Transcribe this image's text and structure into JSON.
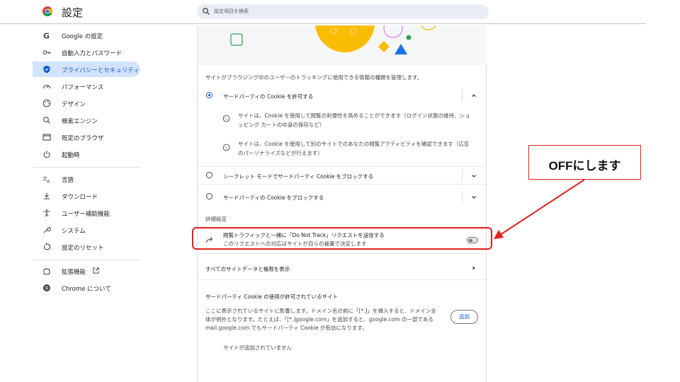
{
  "app": {
    "title": "設定"
  },
  "search": {
    "placeholder": "設定項目を検索"
  },
  "sidebar": {
    "items": [
      {
        "label": "Google の設定",
        "icon": "google-g-icon"
      },
      {
        "label": "自動入力とパスワード",
        "icon": "key-icon"
      },
      {
        "label": "プライバシーとセキュリティ",
        "icon": "shield-icon",
        "active": true
      },
      {
        "label": "パフォーマンス",
        "icon": "speedometer-icon"
      },
      {
        "label": "デザイン",
        "icon": "palette-icon"
      },
      {
        "label": "検索エンジン",
        "icon": "search-icon"
      },
      {
        "label": "既定のブラウザ",
        "icon": "browser-window-icon"
      },
      {
        "label": "起動時",
        "icon": "power-icon"
      },
      {
        "label": "言語",
        "icon": "translate-icon"
      },
      {
        "label": "ダウンロード",
        "icon": "download-icon"
      },
      {
        "label": "ユーザー補助機能",
        "icon": "accessibility-icon"
      },
      {
        "label": "システム",
        "icon": "wrench-icon"
      },
      {
        "label": "設定のリセット",
        "icon": "reset-icon"
      },
      {
        "label": "拡張機能",
        "icon": "puzzle-icon"
      },
      {
        "label": "Chrome について",
        "icon": "chrome-icon"
      }
    ]
  },
  "content": {
    "intro": "サイトがブラウジング中のユーザーのトラッキングに使用できる情報の種類を管理します。",
    "options": [
      {
        "label": "サードパーティの Cookie を許可する",
        "selected": true,
        "expanded": true
      },
      {
        "label": "シークレット モードでサードパーティ Cookie をブロックする",
        "selected": false
      },
      {
        "label": "サードパーティの Cookie をブロックする",
        "selected": false
      }
    ],
    "bullet1_line1": "サイトは、Cookie を使用して閲覧の利便性を高めることができます（ログイン状態の維持、ショ",
    "bullet1_line2": "ッピング カートの中身の保存など）",
    "bullet2_line1": "サイトは、Cookie を使用して別のサイトでのあなたの閲覧アクティビティを確認できます（広告",
    "bullet2_line2": "のパーソナライズなどが行えます）",
    "advanced_heading": "詳細設定",
    "dnt_title": "閲覧トラフィックと一緒に「Do Not Track」リクエストを送信する",
    "dnt_desc": "このリクエストへの対応はサイトが自らの裁量で決定します",
    "dnt_enabled": false,
    "all_site_data": "すべてのサイトデータと権限を表示",
    "allowed_heading": "サードパーティ Cookie の使用が許可されているサイト",
    "allowed_desc_1": "ここに表示されているサイトに影響します。ドメイン名の前に「[*.]」を挿入すると、ドメイン全",
    "allowed_desc_2": "体が例外となります。たとえば、「[*.]google.com」を追加すると、google.com の一部である",
    "allowed_desc_3": "mail.google.com でもサードパーティ Cookie が有効になります。",
    "add_button": "追加",
    "empty_text": "サイトが追加されていません"
  },
  "annotation": {
    "callout_text": "OFFにします",
    "color": "#e0201a"
  },
  "colors": {
    "accent": "#0b57d0",
    "active_bg": "#d3e3fd",
    "search_bg": "#e9eef6"
  }
}
